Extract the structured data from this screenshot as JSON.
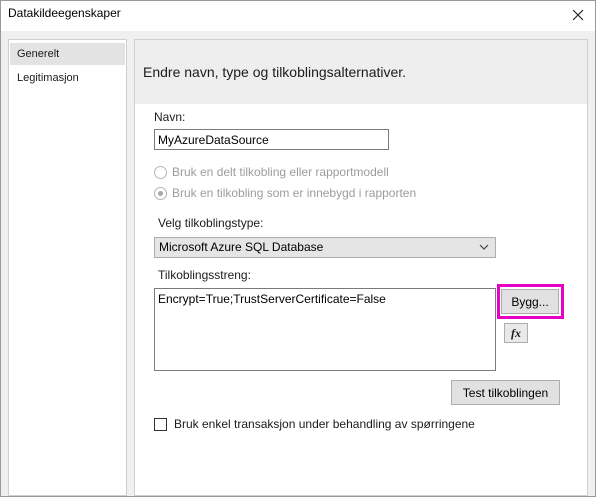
{
  "window": {
    "title": "Datakildeegenskaper"
  },
  "sidebar": {
    "items": [
      {
        "label": "Generelt",
        "selected": true
      },
      {
        "label": "Legitimasjon",
        "selected": false
      }
    ]
  },
  "main": {
    "header": "Endre navn, type og tilkoblingsalternativer.",
    "name_label": "Navn:",
    "name_value": "MyAzureDataSource",
    "radio_shared": "Bruk en delt tilkobling eller rapportmodell",
    "radio_embedded": "Bruk en tilkobling som er innebygd i rapporten",
    "connection_type_label": "Velg tilkoblingstype:",
    "connection_type_value": "Microsoft Azure SQL Database",
    "connection_string_label": "Tilkoblingsstreng:",
    "connection_string_value": "Encrypt=True;TrustServerCertificate=False",
    "build_button": "Bygg...",
    "fx_button": "fx",
    "test_button": "Test tilkoblingen",
    "transaction_checkbox": "Bruk enkel transaksjon under behandling av spørringene"
  },
  "colors": {
    "highlight": "#e800c4"
  }
}
